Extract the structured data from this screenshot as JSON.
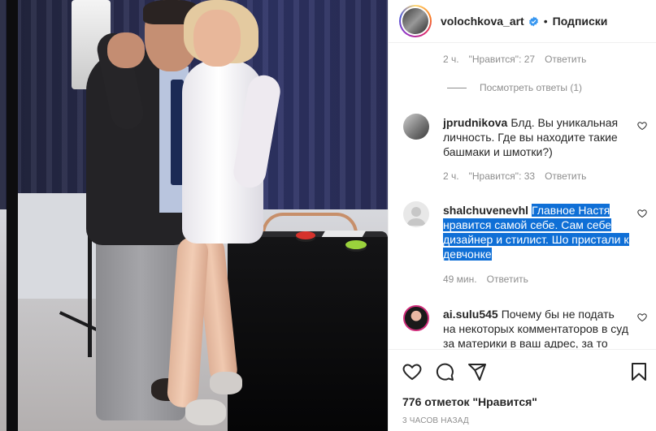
{
  "post": {
    "username": "volochkova_art",
    "separator": "•",
    "follow_label": "Подписки",
    "likes_text": "776 отметок \"Нравится\"",
    "time_text": "3 ЧАСОВ НАЗАД"
  },
  "comments": {
    "first_meta": {
      "time": "2 ч.",
      "likes": "\"Нравится\": 27",
      "reply": "Ответить"
    },
    "view_replies": "Посмотреть ответы (1)",
    "items": [
      {
        "username": "jprudnikova",
        "text": "Блд. Вы уникальная личность. Где вы находите такие башмаки и шмотки?)",
        "time": "2 ч.",
        "likes": "\"Нравится\": 33",
        "reply": "Ответить"
      },
      {
        "username": "shalchuvenevhl",
        "text": "Главное Настя нравится самой себе. Сам себе дизайнер и стилист. Шо пристали к девчонке",
        "time": "49 мин.",
        "reply": "Ответить"
      },
      {
        "username": "ai.sulu545",
        "text": "Почему бы не подать на некоторых комментаторов в суд за материки в ваш адрес, за то"
      }
    ]
  },
  "icons": {
    "like": "heart-icon",
    "comment": "comment-icon",
    "share": "send-icon",
    "save": "bookmark-icon",
    "verified": "verified-badge-icon"
  },
  "colors": {
    "highlight": "#0f6fd6",
    "verified": "#3897f0",
    "muted_text": "#8e8e8e"
  }
}
